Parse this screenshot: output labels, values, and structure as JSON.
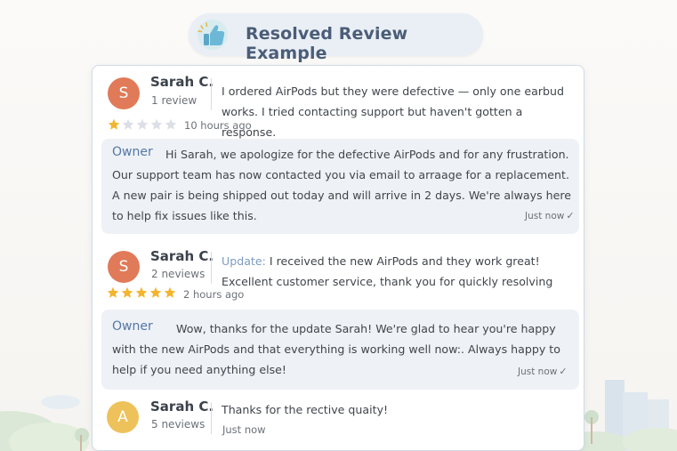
{
  "header": {
    "title": "Resolved Review Example",
    "icon": "thumbs-up-icon"
  },
  "colors": {
    "avatar_orange": "#e07a58",
    "avatar_yellow": "#eec25a",
    "star_filled": "#f2b52e",
    "star_empty": "#dcdfe6",
    "owner_label": "#5577a6"
  },
  "reviews": [
    {
      "initial": "S",
      "name": "Sarah C.",
      "count": "1 review",
      "text": "I ordered AirPods but they were defective — only one earbud works. I tried contacting support but haven't gotten a response.",
      "rating": 1,
      "time": "10 hours ago",
      "owner": {
        "label": "Owner",
        "text_lead": "Hi Sarah, we apologize for the defective AirPods and for any frustration. Our support team has now contacted you via email to arraage for a replacement. A new pair is being shipped out today and will arrive in 2 days. We're always here to help fix issues like this.",
        "time": "Just now"
      }
    },
    {
      "initial": "S",
      "name": "Sarah C.",
      "count": "2 neviews",
      "update_label": "Update:",
      "text": "I received the new AirPods and they work great! Excellent customer service, thank you for quickly resolving",
      "rating": 5,
      "time": "2 hours ago",
      "owner": {
        "label": "Owner",
        "text_lead": "Wow, thanks for the update Sarah! We're glad to hear you're happy with the new AirPods and that everything is working well now:. Always happy to help if you need anything else!",
        "time": "Just now"
      }
    },
    {
      "initial": "A",
      "name": "Sarah C.",
      "count": "5 neviews",
      "text": "Thanks for the rective quaity!",
      "time": "Just now"
    }
  ]
}
